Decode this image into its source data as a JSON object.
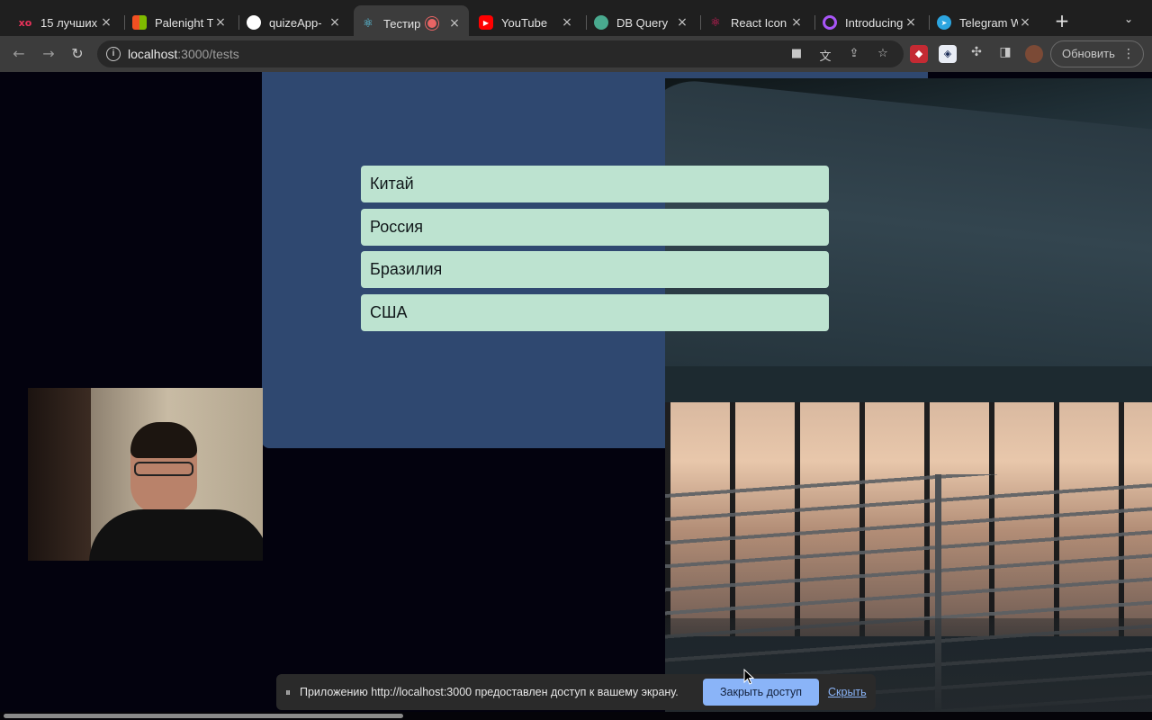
{
  "browser": {
    "tabs": [
      {
        "title": "15 лучших",
        "icon": "xo-icon",
        "color": "#e8325a"
      },
      {
        "title": "Palenight T",
        "icon": "microsoft-icon",
        "color": "#f25022"
      },
      {
        "title": "quizeApp-",
        "icon": "github-icon",
        "color": "#ffffff"
      },
      {
        "title": "Тестир",
        "icon": "react-icon",
        "color": "#61dafb",
        "active": true,
        "recording": true
      },
      {
        "title": "YouTube",
        "icon": "youtube-icon",
        "color": "#ff0000"
      },
      {
        "title": "DB Query",
        "icon": "db-query-icon",
        "color": "#49a98e"
      },
      {
        "title": "React Icon",
        "icon": "react-icons-icon",
        "color": "#e91e63"
      },
      {
        "title": "Introducing",
        "icon": "introducing-icon",
        "color": "#a855f7"
      },
      {
        "title": "Telegram W",
        "icon": "telegram-icon",
        "color": "#2ca5e0"
      }
    ],
    "close_glyph": "×",
    "new_tab_glyph": "+",
    "tab_menu_glyph": "⌄",
    "back_glyph": "←",
    "forward_glyph": "→",
    "reload_glyph": "↻",
    "url_host": "localhost",
    "url_rest": ":3000/tests",
    "update_label": "Обновить",
    "menu_glyph": "⋮"
  },
  "quiz": {
    "answers": [
      "Китай",
      "Россия",
      "Бразилия",
      "США"
    ]
  },
  "share_bar": {
    "grip": "⏸",
    "message": "Приложению http://localhost:3000 предоставлен доступ к вашему экрану.",
    "stop_label": "Закрыть доступ",
    "hide_label": "Скрыть"
  }
}
